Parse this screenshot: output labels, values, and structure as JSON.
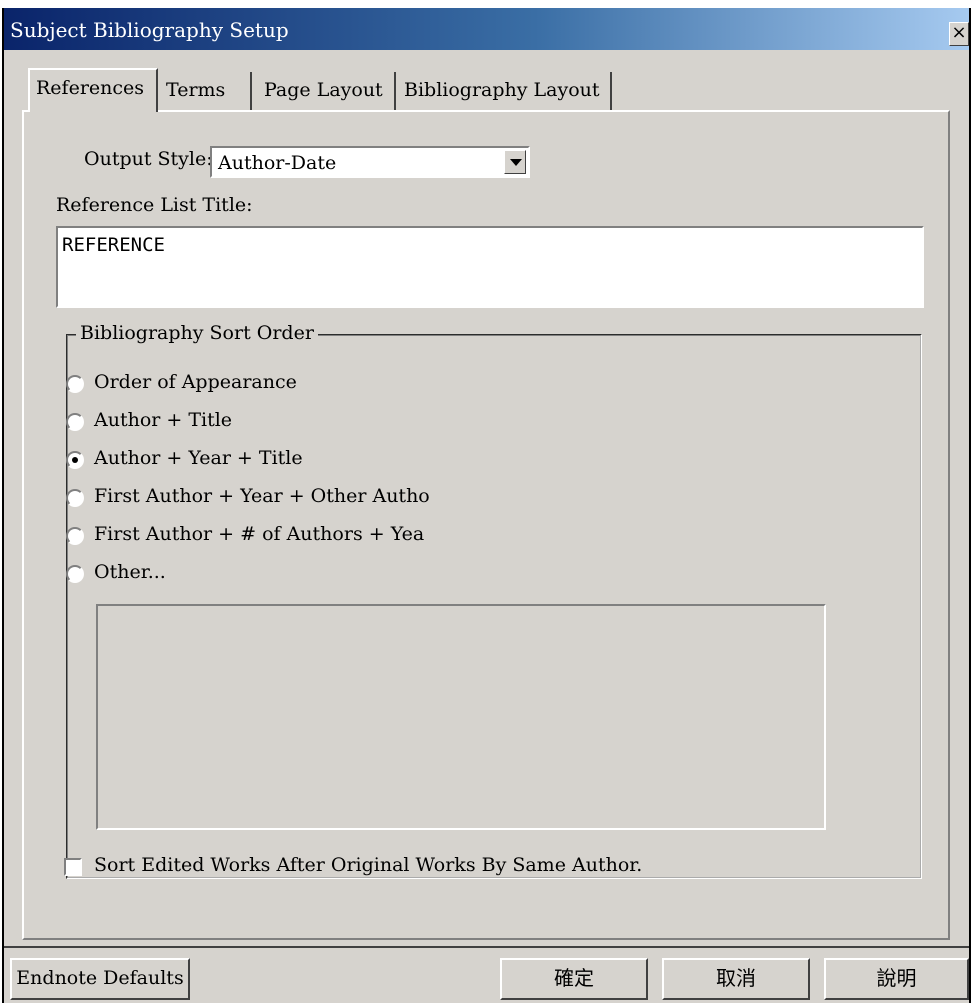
{
  "window": {
    "title": "Subject Bibliography Setup",
    "close_label": "×"
  },
  "tabs": [
    {
      "label": "References",
      "active": true
    },
    {
      "label": "Terms",
      "active": false
    },
    {
      "label": "Page Layout",
      "active": false
    },
    {
      "label": "Bibliography Layout",
      "active": false
    }
  ],
  "output_style": {
    "label": "Output Style:",
    "value": "Author-Date"
  },
  "reference_list_title": {
    "label": "Reference List Title:",
    "value": "REFERENCE"
  },
  "sort_order": {
    "group_label": "Bibliography Sort Order",
    "options": [
      {
        "label": "Order of Appearance",
        "selected": false
      },
      {
        "label": "Author + Title",
        "selected": false
      },
      {
        "label": "Author + Year + Title",
        "selected": true
      },
      {
        "label": "First Author + Year + Other Autho",
        "selected": false
      },
      {
        "label": "First Author +  # of Authors + Yea",
        "selected": false
      },
      {
        "label": "Other...",
        "selected": false
      }
    ],
    "other_value": ""
  },
  "sort_edited_works": {
    "label": "Sort Edited  Works After Original Works By Same Author.",
    "checked": false
  },
  "buttons": {
    "defaults": "Endnote Defaults",
    "ok": "確定",
    "cancel": "取消",
    "help": "說明"
  }
}
